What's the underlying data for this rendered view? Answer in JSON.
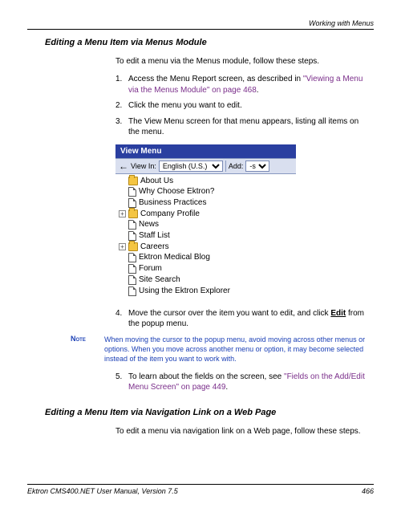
{
  "header": {
    "chapter": "Working with Menus"
  },
  "section1": {
    "title": "Editing a Menu Item via Menus Module",
    "intro": "To edit a menu via the Menus module, follow these steps.",
    "step1_pre": "Access the Menu Report screen, as described in ",
    "step1_link": "\"Viewing a Menu via the Menus Module\" on page 468",
    "step1_post": ".",
    "step2": "Click the menu you want to edit.",
    "step3": "The View Menu screen for that menu appears, listing all items on the menu.",
    "step4_pre": "Move the cursor over the item you want to edit, and click ",
    "step4_bold": "Edit",
    "step4_post": " from the popup menu.",
    "step5_pre": "To learn about the fields on the screen, see ",
    "step5_link": "\"Fields on the Add/Edit Menu Screen\" on page 449",
    "step5_post": "."
  },
  "note": {
    "label": "Note",
    "text": "When moving the cursor to the popup menu, avoid moving across other menus or options. When you move across another menu or option, it may become selected instead of the item you want to work with."
  },
  "embed": {
    "title": "View Menu",
    "viewin": "View In:",
    "lang": "English (U.S.)",
    "add": "Add:",
    "add_val": "-sele",
    "items": [
      {
        "type": "folder",
        "label": "About Us",
        "expandable": false
      },
      {
        "type": "page",
        "label": "Why Choose Ektron?",
        "expandable": false
      },
      {
        "type": "page",
        "label": "Business Practices",
        "expandable": false
      },
      {
        "type": "folder",
        "label": "Company Profile",
        "expandable": true
      },
      {
        "type": "page",
        "label": "News",
        "expandable": false
      },
      {
        "type": "page",
        "label": "Staff List",
        "expandable": false
      },
      {
        "type": "folder",
        "label": "Careers",
        "expandable": true
      },
      {
        "type": "page",
        "label": "Ektron Medical Blog",
        "expandable": false
      },
      {
        "type": "page",
        "label": "Forum",
        "expandable": false
      },
      {
        "type": "page",
        "label": "Site Search",
        "expandable": false
      },
      {
        "type": "page",
        "label": "Using the Ektron Explorer",
        "expandable": false
      }
    ]
  },
  "section2": {
    "title": "Editing a Menu Item via Navigation Link on a Web Page",
    "intro": "To edit a menu via navigation link on a Web page, follow these steps."
  },
  "footer": {
    "left": "Ektron CMS400.NET User Manual, Version 7.5",
    "right": "466"
  },
  "nums": {
    "n1": "1.",
    "n2": "2.",
    "n3": "3.",
    "n4": "4.",
    "n5": "5."
  }
}
